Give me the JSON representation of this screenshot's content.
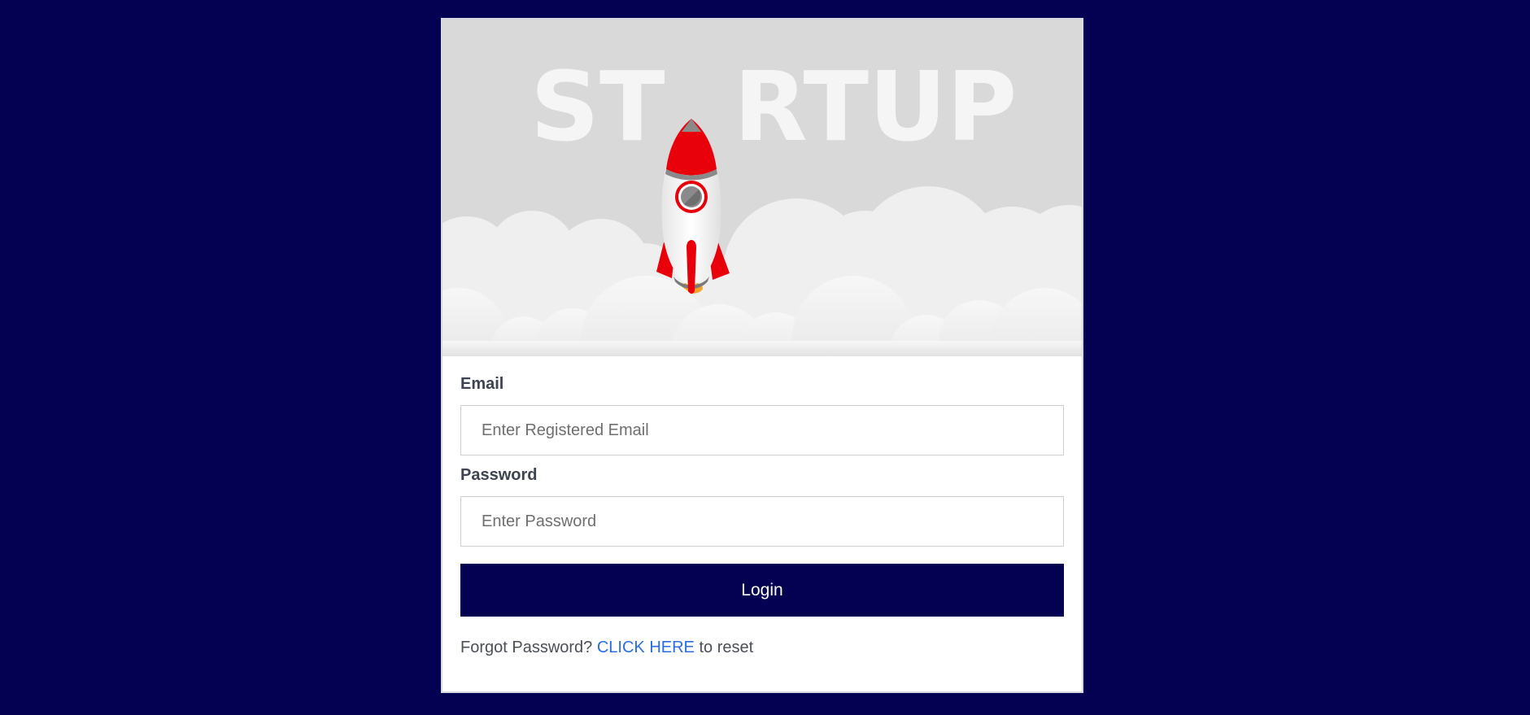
{
  "hero": {
    "word": "STARTUP",
    "word_left": "ST",
    "word_right": "RTUP",
    "colors": {
      "sky": "#d9d9d9",
      "letters": "#f5f5f5",
      "rocket_red": "#e8000b",
      "rocket_body": "#f4f4f4",
      "rocket_gray": "#8a8a8a"
    },
    "icons": [
      "rocket-icon",
      "cloud-bank"
    ]
  },
  "form": {
    "email_label": "Email",
    "email_placeholder": "Enter Registered Email",
    "email_value": "",
    "password_label": "Password",
    "password_placeholder": "Enter Password",
    "password_value": "",
    "login_label": "Login",
    "forgot_prefix": "Forgot Password?",
    "forgot_link": "CLICK HERE",
    "forgot_suffix": "to reset"
  },
  "colors": {
    "background": "#050152",
    "button": "#050152",
    "link": "#2b6de0",
    "label": "#3d4450"
  }
}
